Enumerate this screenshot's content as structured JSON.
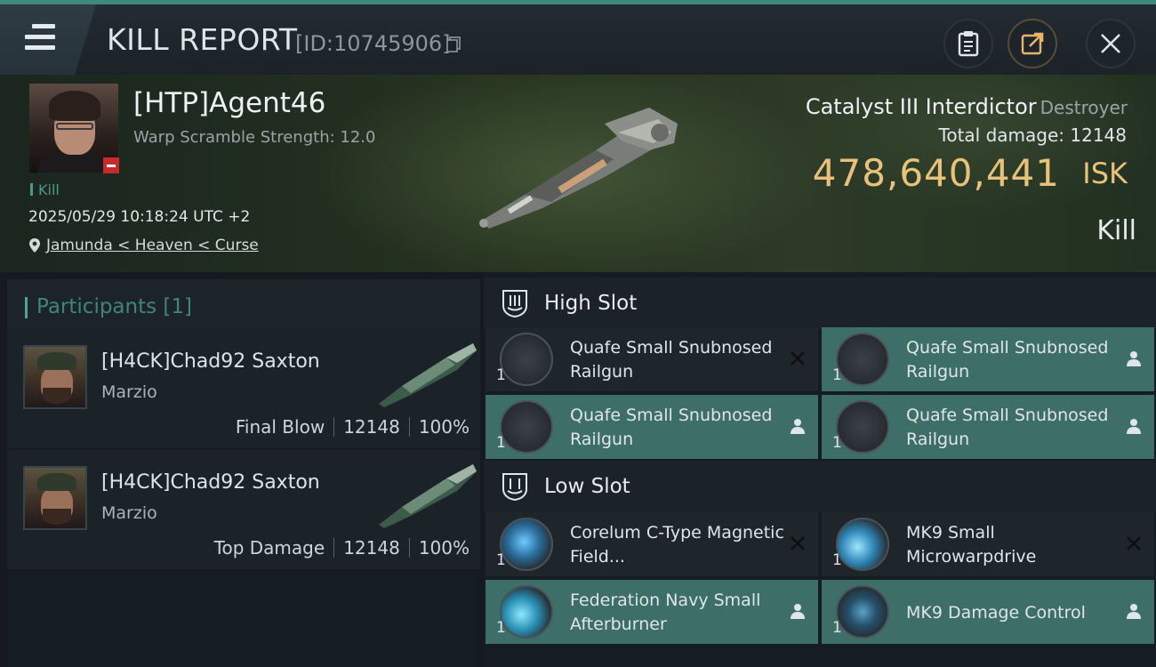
{
  "header": {
    "title": "KILL REPORT",
    "report_id": "[ID:10745906]"
  },
  "victim": {
    "name": "[HTP]Agent46",
    "warp_scramble": "Warp Scramble Strength: 12.0",
    "tag": "Kill",
    "timestamp": "2025/05/29 10:18:24 UTC +2",
    "location": "Jamunda < Heaven < Curse"
  },
  "ship": {
    "name": "Catalyst III Interdictor",
    "class": "Destroyer",
    "total_damage_label": "Total damage:",
    "total_damage": "12148",
    "isk_value": "478,640,441",
    "isk_unit": "ISK",
    "result": "Kill"
  },
  "participants": {
    "title": "Participants",
    "count": "[1]",
    "rows": [
      {
        "name": "[H4CK]Chad92 Saxton",
        "ship": "Marzio",
        "role": "Final Blow",
        "damage": "12148",
        "percent": "100%"
      },
      {
        "name": "[H4CK]Chad92 Saxton",
        "ship": "Marzio",
        "role": "Top Damage",
        "damage": "12148",
        "percent": "100%"
      }
    ]
  },
  "fitting": {
    "high_slot": {
      "label": "High Slot",
      "modules": [
        {
          "name": "Quafe Small Snubnosed Railgun",
          "qty": "1",
          "status": "destroyed"
        },
        {
          "name": "Quafe Small Snubnosed Railgun",
          "qty": "1",
          "status": "dropped"
        },
        {
          "name": "Quafe Small Snubnosed Railgun",
          "qty": "1",
          "status": "dropped"
        },
        {
          "name": "Quafe Small Snubnosed Railgun",
          "qty": "1",
          "status": "dropped"
        }
      ]
    },
    "low_slot": {
      "label": "Low Slot",
      "modules": [
        {
          "name": "Corelum C-Type Magnetic Field...",
          "qty": "1",
          "status": "destroyed"
        },
        {
          "name": "MK9 Small Microwarpdrive",
          "qty": "1",
          "status": "destroyed"
        },
        {
          "name": "Federation Navy Small Afterburner",
          "qty": "1",
          "status": "dropped"
        },
        {
          "name": "MK9 Damage Control",
          "qty": "1",
          "status": "dropped"
        }
      ]
    }
  },
  "colors": {
    "accent_teal": "#3d6e67",
    "isk_gold": "#e8c27a",
    "header_stripe": "#3f8a7e",
    "kill_red": "#c72a2a"
  }
}
